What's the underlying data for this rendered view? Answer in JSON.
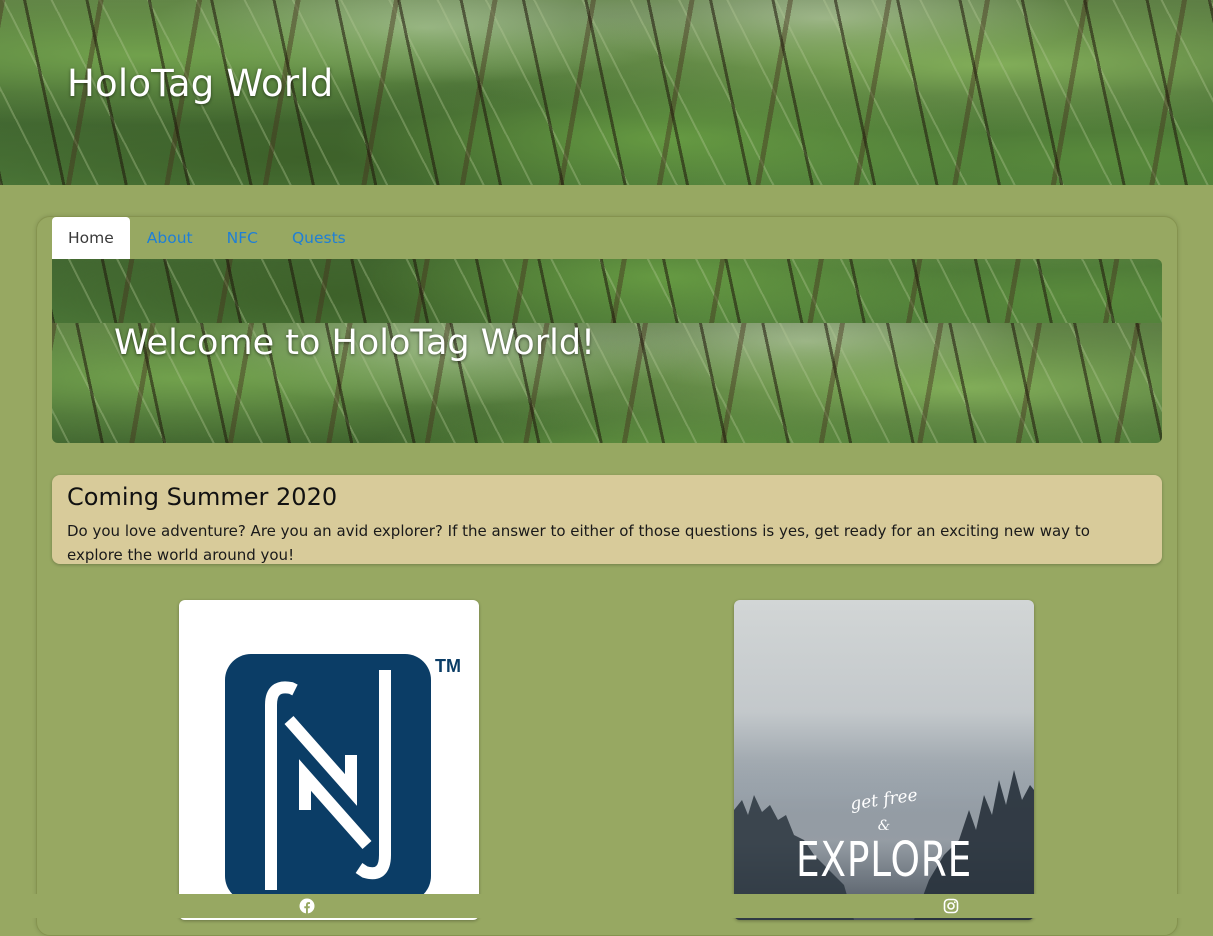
{
  "header": {
    "site_title": "HoloTag World"
  },
  "nav": {
    "tabs": [
      {
        "label": "Home",
        "active": true
      },
      {
        "label": "About",
        "active": false
      },
      {
        "label": "NFC",
        "active": false
      },
      {
        "label": "Quests",
        "active": false
      }
    ]
  },
  "hero": {
    "title": "Welcome to HoloTag World!"
  },
  "announcement": {
    "title": "Coming Summer 2020",
    "text": "Do you love adventure? Are you an avid explorer? If the answer to either of those questions is yes, get ready for an exciting new way to explore the world around you!"
  },
  "cards": {
    "nfc": {
      "logo": "nfc-logo",
      "trademark": "TM"
    },
    "explore": {
      "script": "get free",
      "amp": "&",
      "headline": "EXPLORE"
    }
  },
  "footer": {
    "icons": [
      "facebook-icon",
      "instagram-icon"
    ]
  },
  "colors": {
    "page_bg": "#97a862",
    "tab_link": "#1f7fd6",
    "announcement_bg": "#d8cb9a",
    "nfc_blue": "#0b3d66"
  }
}
